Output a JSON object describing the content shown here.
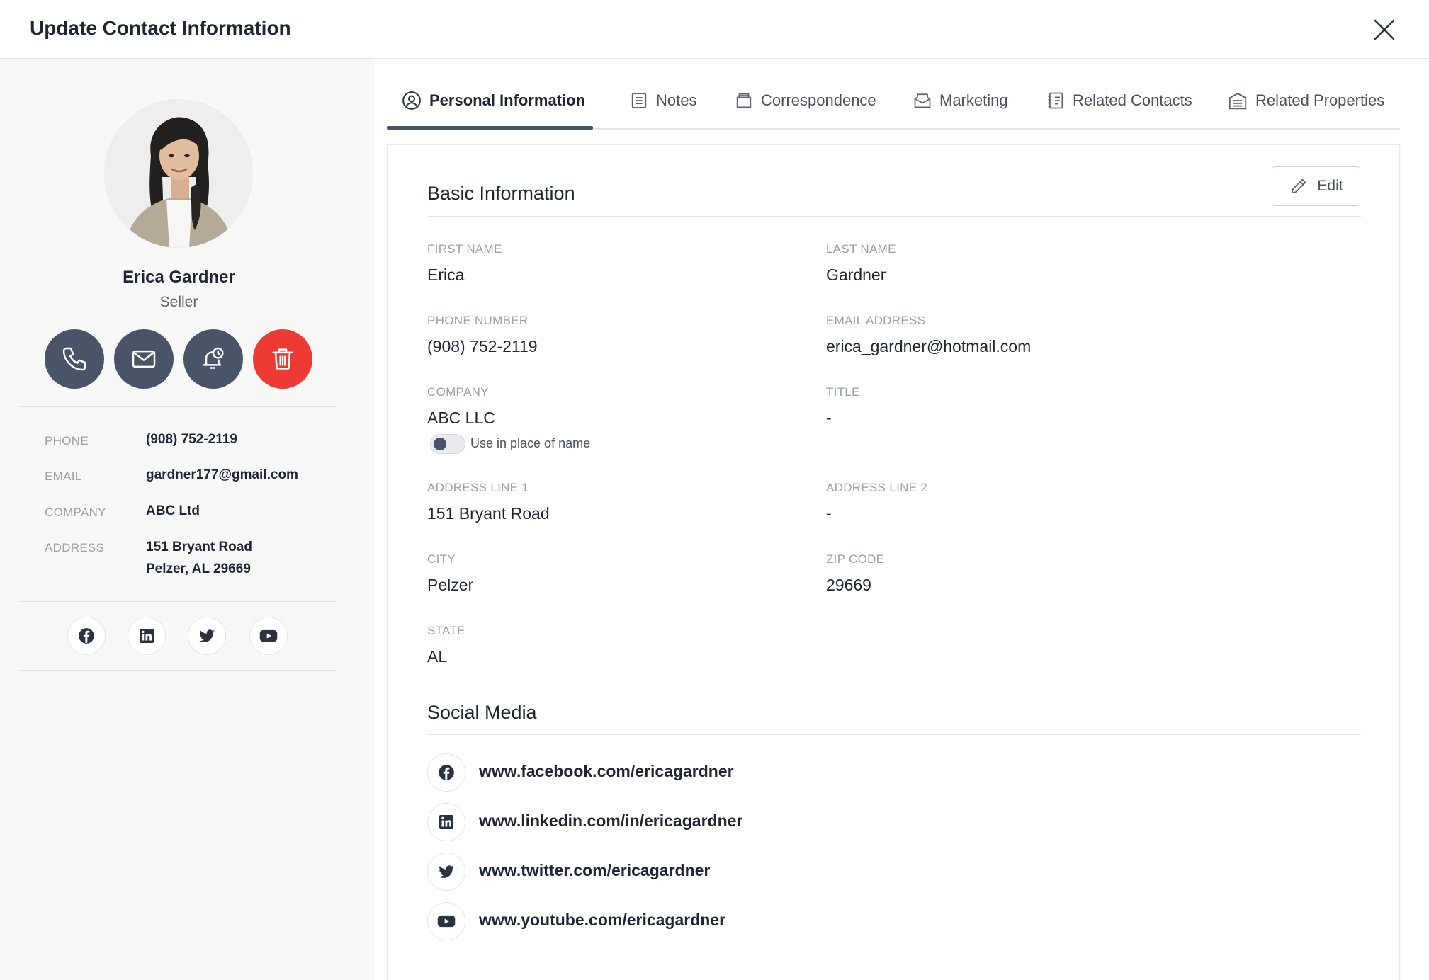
{
  "header": {
    "title": "Update Contact Information"
  },
  "contact": {
    "name": "Erica Gardner",
    "role": "Seller"
  },
  "sidebar": {
    "info": [
      {
        "label": "PHONE",
        "value": "(908) 752-2119"
      },
      {
        "label": "EMAIL",
        "value": "gardner177@gmail.com"
      },
      {
        "label": "COMPANY",
        "value": "ABC Ltd"
      },
      {
        "label": "ADDRESS",
        "value": "151 Bryant Road",
        "value2": "Pelzer, AL 29669"
      }
    ]
  },
  "tabs": [
    {
      "label": "Personal Information",
      "icon": "user-circle-icon",
      "active": true
    },
    {
      "label": "Notes",
      "icon": "notes-icon"
    },
    {
      "label": "Correspondence",
      "icon": "inbox-icon"
    },
    {
      "label": "Marketing",
      "icon": "envelope-open-icon"
    },
    {
      "label": "Related Contacts",
      "icon": "address-book-icon"
    },
    {
      "label": "Related Properties",
      "icon": "building-icon"
    }
  ],
  "basic": {
    "title": "Basic Information",
    "edit_label": "Edit",
    "fields": {
      "first_name": {
        "label": "FIRST NAME",
        "value": "Erica"
      },
      "last_name": {
        "label": "LAST NAME",
        "value": "Gardner"
      },
      "phone": {
        "label": "PHONE NUMBER",
        "value": "(908) 752-2119"
      },
      "email": {
        "label": "EMAIL ADDRESS",
        "value": "erica_gardner@hotmail.com"
      },
      "company": {
        "label": "COMPANY",
        "value": "ABC LLC"
      },
      "title": {
        "label": "TITLE",
        "value": "-"
      },
      "address1": {
        "label": "ADDRESS LINE 1",
        "value": "151 Bryant Road"
      },
      "address2": {
        "label": "ADDRESS LINE 2",
        "value": "-"
      },
      "city": {
        "label": "CITY",
        "value": "Pelzer"
      },
      "zip": {
        "label": "ZIP CODE",
        "value": "29669"
      },
      "state": {
        "label": "STATE",
        "value": "AL"
      }
    },
    "toggle_label": "Use in place of name",
    "toggle_on": false
  },
  "social": {
    "title": "Social Media",
    "links": [
      {
        "icon": "facebook-icon",
        "url": "www.facebook.com/ericagardner"
      },
      {
        "icon": "linkedin-icon",
        "url": "www.linkedin.com/in/ericagardner"
      },
      {
        "icon": "twitter-icon",
        "url": "www.twitter.com/ericagardner"
      },
      {
        "icon": "youtube-icon",
        "url": "www.youtube.com/ericagardner"
      }
    ]
  },
  "colors": {
    "accent": "#4a5468",
    "danger": "#ee3a34",
    "text": "#1f2633",
    "muted": "#9aa0a8",
    "sidebar_bg": "#f8f8f9"
  }
}
